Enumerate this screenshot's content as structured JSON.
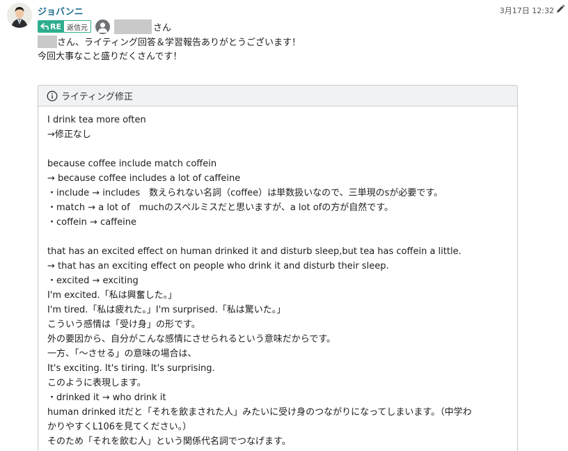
{
  "message": {
    "sender": "ジョバンニ",
    "timestamp": "3月17日 12:32",
    "reply_badge": "RE",
    "reply_source_label": "返信元",
    "honorific": "さん",
    "greeting_suffix": "さん、ライティング回答＆学習報告ありがとうございます！",
    "line2": "今回大事なこと盛りだくさんです！"
  },
  "card": {
    "title": "ライティング修正",
    "lines": [
      "I drink tea more often",
      "→修正なし",
      "",
      "because coffee include match coffein",
      "→ because coffee includes a lot of caffeine",
      "・include → includes　数えられない名詞（coffee）は単数扱いなので、三単現のsが必要です。",
      "・match → a lot of　muchのスペルミスだと思いますが、a lot ofの方が自然です。",
      "・coffein → caffeine",
      "",
      "that has an excited effect on human drinked it and disturb sleep,but tea has coffein a little.",
      "→ that has an exciting effect on people who drink it and disturb their sleep.",
      "・excited → exciting",
      "I'm excited.「私は興奮した。」",
      "I'm tired.「私は疲れた。」I'm surprised.「私は驚いた。」",
      "こういう感情は「受け身」の形です。",
      "外の要因から、自分がこんな感情にさせられるという意味だからです。",
      "一方、「〜させる」の意味の場合は、",
      "It's exciting. It's tiring. It's surprising.",
      "このように表現します。",
      "・drinked it → who drink it",
      "human drinked itだと「それを飲まされた人」みたいに受け身のつながりになってしまいます。（中学わ",
      "かりやすくL106を見てください。）",
      "そのため「それを飲む人」という関係代名詞でつなげます。"
    ]
  },
  "colors": {
    "sender": "#1d6b8f",
    "reply_badge": "#2fae8f",
    "card_header_bg": "#f1f2f4"
  },
  "icons": [
    "reply-arrow-icon",
    "user-icon",
    "info-icon",
    "pencil-icon"
  ]
}
